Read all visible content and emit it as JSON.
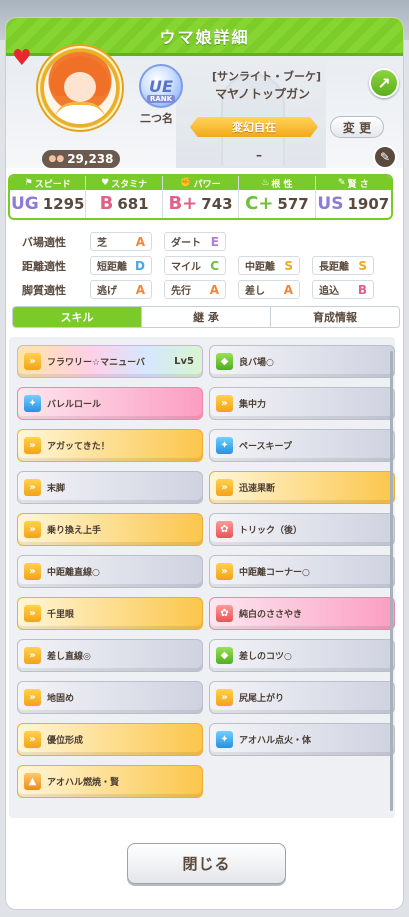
{
  "header": {
    "title": "ウマ娘詳細"
  },
  "profile": {
    "fans": "29,238",
    "rank_badge": "UE",
    "rank_label": "RANK",
    "nickname": "二つ名",
    "subtitle": "[サンライト・ブーケ]",
    "name": "マヤノトップガン",
    "title_ribbon": "変幻自在",
    "change_label": "変 更",
    "dash": "–"
  },
  "stats": [
    {
      "label": "スピード",
      "icon": "shoe-icon",
      "grade": "UG",
      "value": "1295"
    },
    {
      "label": "スタミナ",
      "icon": "heart-icon",
      "grade": "B",
      "value": "681"
    },
    {
      "label": "パワー",
      "icon": "muscle-icon",
      "grade": "B+",
      "value": "743"
    },
    {
      "label": "根 性",
      "icon": "flame-icon",
      "grade": "C+",
      "value": "577"
    },
    {
      "label": "賢 さ",
      "icon": "book-icon",
      "grade": "US",
      "value": "1907"
    }
  ],
  "aptitudes": {
    "track": {
      "label": "バ場適性",
      "items": [
        {
          "name": "芝",
          "grade": "A"
        },
        {
          "name": "ダート",
          "grade": "E"
        }
      ]
    },
    "distance": {
      "label": "距離適性",
      "items": [
        {
          "name": "短距離",
          "grade": "D"
        },
        {
          "name": "マイル",
          "grade": "C"
        },
        {
          "name": "中距離",
          "grade": "S"
        },
        {
          "name": "長距離",
          "grade": "S"
        }
      ]
    },
    "style": {
      "label": "脚質適性",
      "items": [
        {
          "name": "逃げ",
          "grade": "A"
        },
        {
          "name": "先行",
          "grade": "A"
        },
        {
          "name": "差し",
          "grade": "A"
        },
        {
          "name": "追込",
          "grade": "B"
        }
      ]
    }
  },
  "tabs": [
    "スキル",
    "継 承",
    "育成情報"
  ],
  "skills": [
    {
      "name": "フラワリー☆マニューバ",
      "level": "Lv5",
      "style": "rainbow",
      "icon": "yellow"
    },
    {
      "name": "良バ場○",
      "style": "gray",
      "icon": "green"
    },
    {
      "name": "バレルロール",
      "style": "pink",
      "icon": "blue"
    },
    {
      "name": "集中力",
      "style": "gray",
      "icon": "yellow"
    },
    {
      "name": "アガッてきた！",
      "style": "gold",
      "icon": "yellow"
    },
    {
      "name": "ペースキープ",
      "style": "gray",
      "icon": "blue"
    },
    {
      "name": "末脚",
      "style": "gray",
      "icon": "yellow"
    },
    {
      "name": "迅速果断",
      "style": "gold",
      "icon": "yellow"
    },
    {
      "name": "乗り換え上手",
      "style": "gold",
      "icon": "yellow"
    },
    {
      "name": "トリック（後）",
      "style": "gray",
      "icon": "red"
    },
    {
      "name": "中距離直線○",
      "style": "gray",
      "icon": "yellow"
    },
    {
      "name": "中距離コーナー○",
      "style": "gray",
      "icon": "yellow"
    },
    {
      "name": "千里眼",
      "style": "gold",
      "icon": "yellow"
    },
    {
      "name": "純白のささやき",
      "style": "pink",
      "icon": "red"
    },
    {
      "name": "差し直線◎",
      "style": "gray",
      "icon": "yellow"
    },
    {
      "name": "差しのコツ○",
      "style": "gray",
      "icon": "green"
    },
    {
      "name": "地固め",
      "style": "gray",
      "icon": "yellow"
    },
    {
      "name": "尻尾上がり",
      "style": "gray",
      "icon": "yellow"
    },
    {
      "name": "優位形成",
      "style": "gold",
      "icon": "yellow"
    },
    {
      "name": "アオハル点火・体",
      "style": "gray",
      "icon": "blue"
    },
    {
      "name": "アオハル燃焼・賢",
      "style": "gold",
      "icon": "orange"
    }
  ],
  "close_label": "閉じる"
}
